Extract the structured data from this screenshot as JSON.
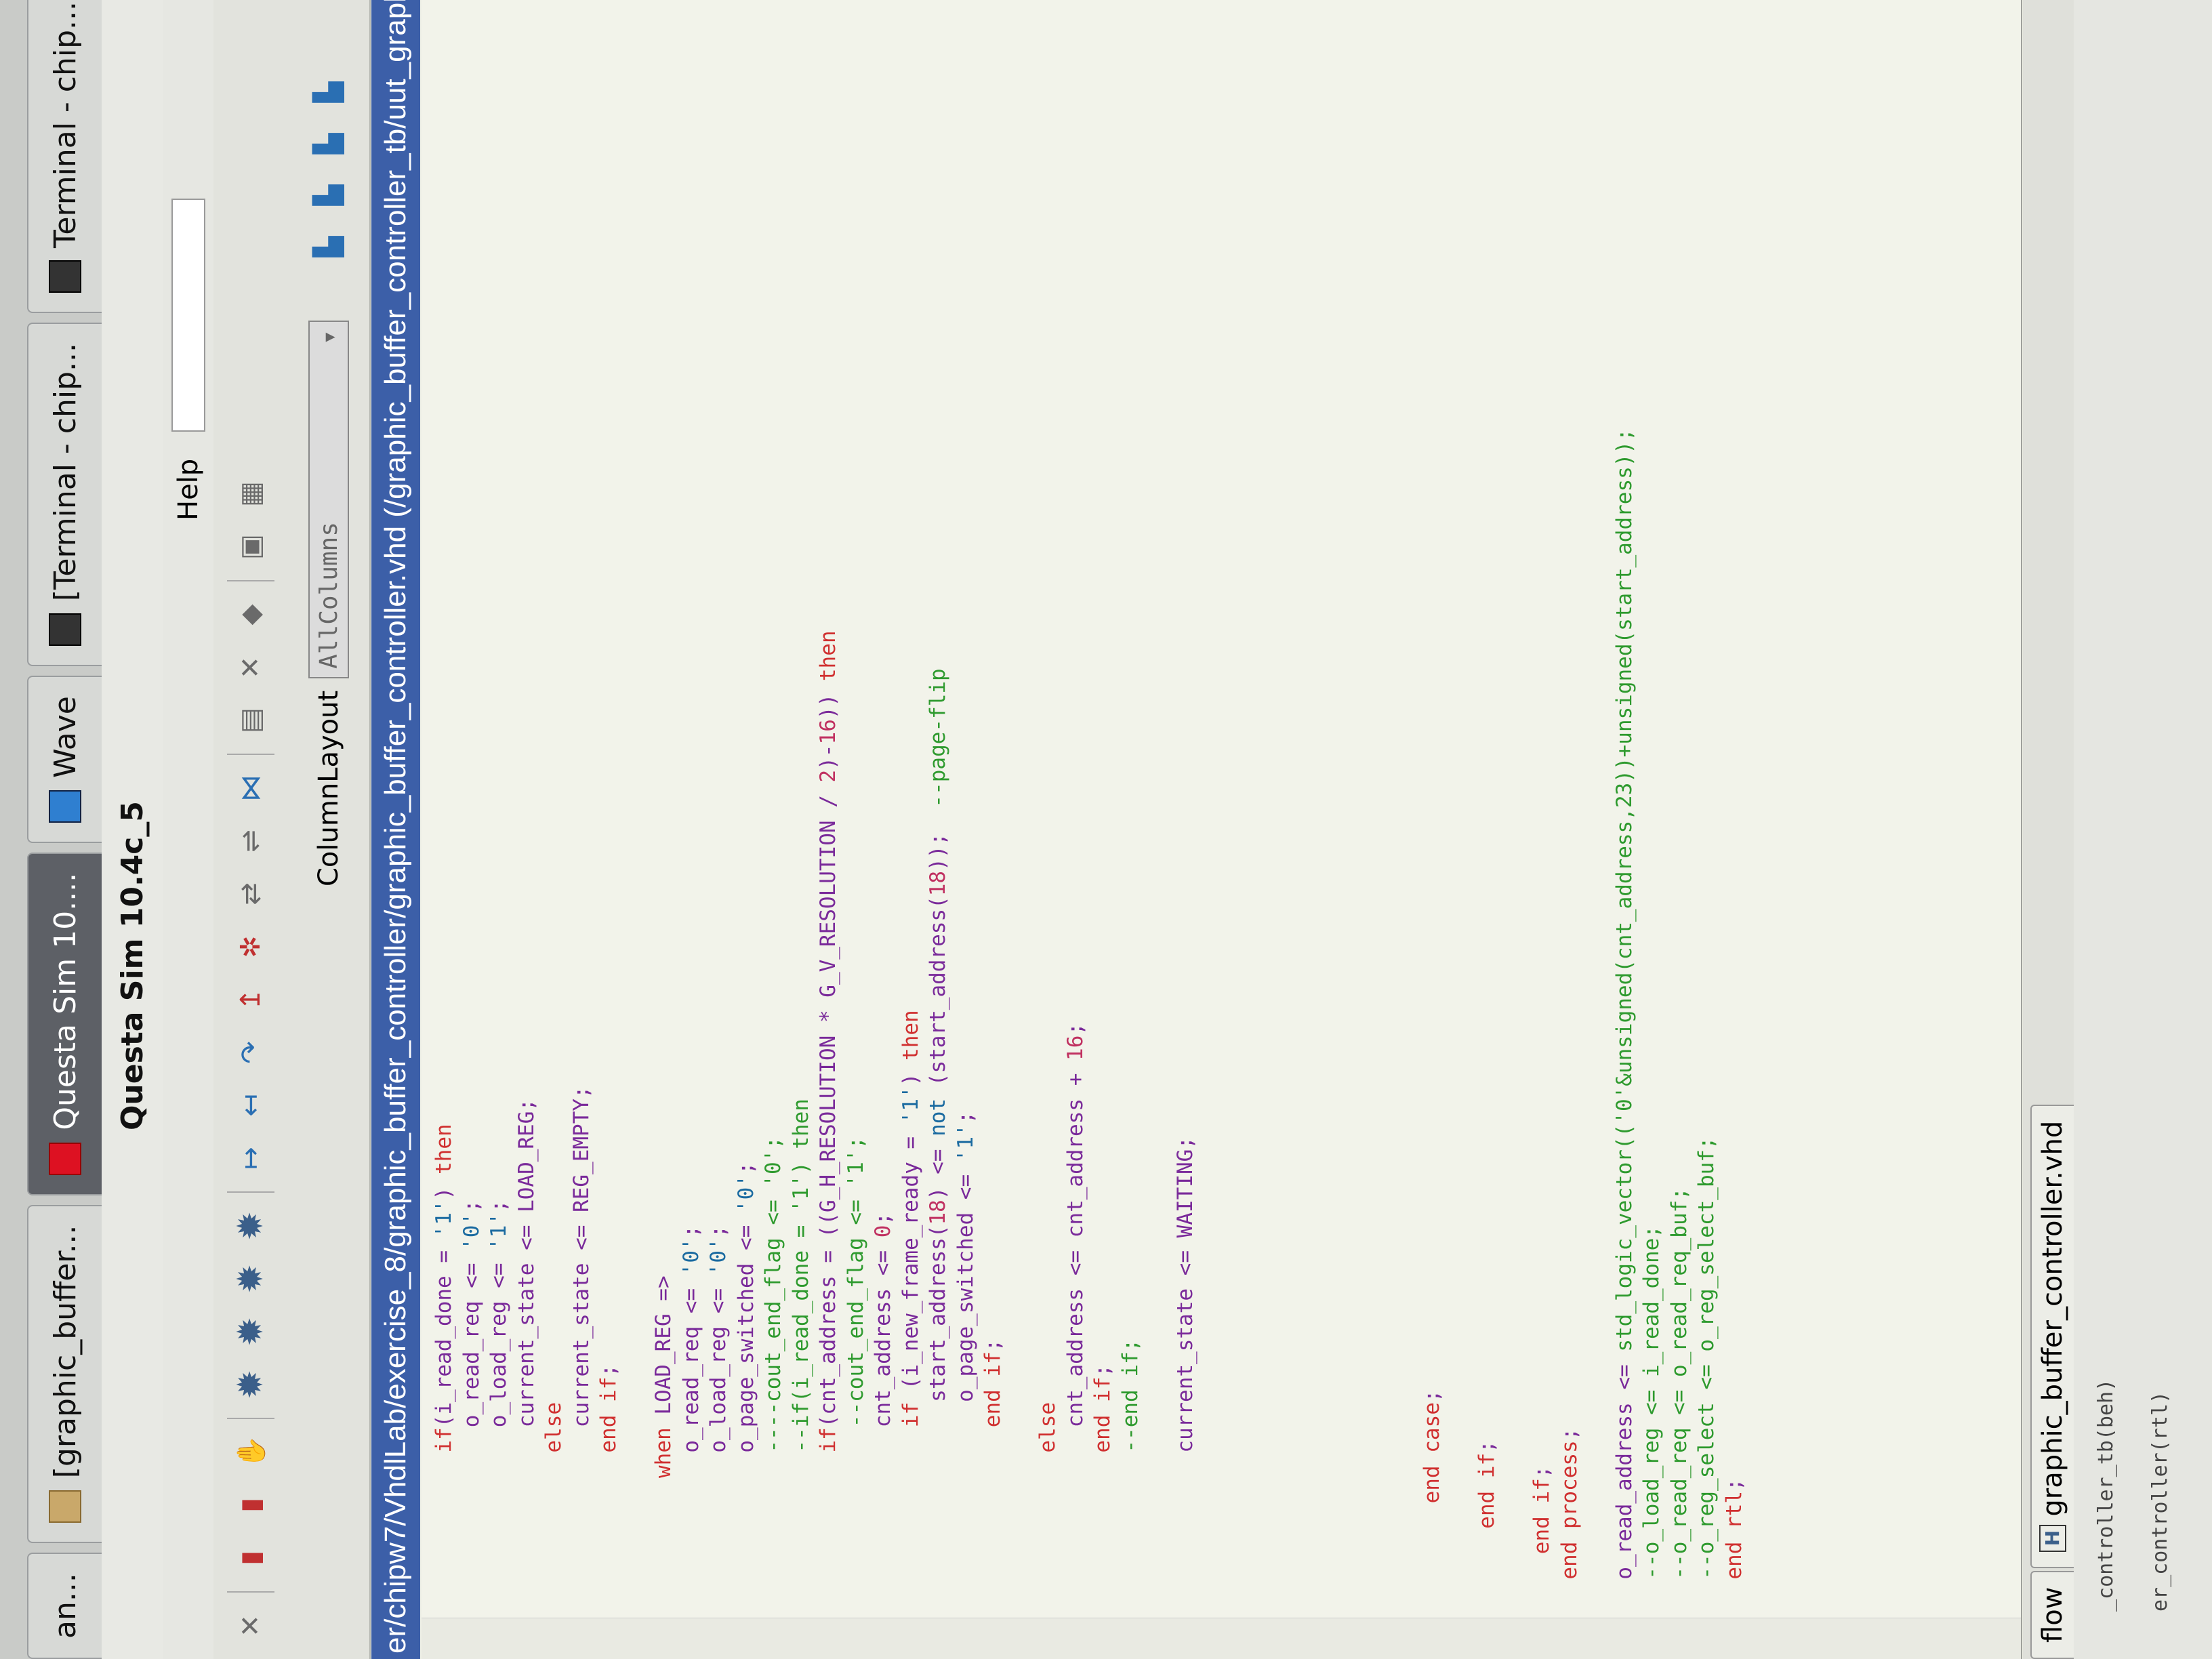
{
  "taskbar": {
    "items": [
      {
        "label": "an...",
        "icon": "app-icon"
      },
      {
        "label": "[graphic_buffer...",
        "icon": "folder-icon"
      },
      {
        "label": "Questa Sim 10....",
        "icon": "questa-icon"
      },
      {
        "label": "Wave",
        "icon": "wave-icon"
      },
      {
        "label": "[Terminal - chip...",
        "icon": "terminal-icon"
      },
      {
        "label": "Terminal - chip...",
        "icon": "terminal-icon"
      }
    ]
  },
  "window": {
    "title": "Questa Sim 10.4c_5"
  },
  "menubar": {
    "help": "Help"
  },
  "toolbar2": {
    "layout_label": "ColumnLayout",
    "layout_value": "AllColumns"
  },
  "path": "er/chipw7/VhdlLab/exercise_8/graphic_buffer_controller/graphic_buffer_controller.vhd (/graphic_buffer_controller_tb/uut_graphic_b",
  "code": [
    {
      "indent": 12,
      "segs": [
        [
          "kw",
          "if"
        ],
        [
          "id",
          "(i_read_done = "
        ],
        [
          "lit",
          "'1'"
        ],
        [
          "id",
          ") "
        ],
        [
          "kw",
          "then"
        ]
      ]
    },
    {
      "indent": 14,
      "segs": [
        [
          "id",
          "o_read_req <= "
        ],
        [
          "lit",
          "'0'"
        ],
        [
          "id",
          ";"
        ]
      ]
    },
    {
      "indent": 14,
      "segs": [
        [
          "id",
          "o_load_reg <= "
        ],
        [
          "lit",
          "'1'"
        ],
        [
          "id",
          ";"
        ]
      ]
    },
    {
      "indent": 14,
      "segs": [
        [
          "id",
          "current_state <= LOAD_REG;"
        ]
      ]
    },
    {
      "indent": 12,
      "segs": [
        [
          "kw",
          "else"
        ]
      ]
    },
    {
      "indent": 14,
      "segs": [
        [
          "id",
          "current_state <= REG_EMPTY;"
        ]
      ]
    },
    {
      "indent": 12,
      "segs": [
        [
          "kw",
          "end if"
        ],
        [
          "id",
          ";"
        ]
      ]
    },
    {
      "indent": 0,
      "segs": []
    },
    {
      "indent": 10,
      "segs": [
        [
          "kw",
          "when"
        ],
        [
          "id",
          " LOAD_REG =>"
        ]
      ]
    },
    {
      "indent": 12,
      "segs": [
        [
          "id",
          "o_read_req <= "
        ],
        [
          "lit",
          "'0'"
        ],
        [
          "id",
          ";"
        ]
      ]
    },
    {
      "indent": 12,
      "segs": [
        [
          "id",
          "o_load_reg <= "
        ],
        [
          "lit",
          "'0'"
        ],
        [
          "id",
          ";"
        ]
      ]
    },
    {
      "indent": 12,
      "segs": [
        [
          "id",
          "o_page_switched <= "
        ],
        [
          "lit",
          "'0'"
        ],
        [
          "id",
          ";"
        ]
      ]
    },
    {
      "indent": 12,
      "segs": [
        [
          "cm",
          "----cout_end_flag <= '0';"
        ]
      ]
    },
    {
      "indent": 12,
      "segs": [
        [
          "cm",
          "--if(i_read_done = '1') then"
        ]
      ]
    },
    {
      "indent": 12,
      "segs": [
        [
          "kw",
          "if"
        ],
        [
          "id",
          "(cnt_address = ((G_H_RESOLUTION * G_V_RESOLUTION / "
        ],
        [
          "nm",
          "2"
        ],
        [
          "id",
          ")-"
        ],
        [
          "nm",
          "16"
        ],
        [
          "id",
          ")) "
        ],
        [
          "kw",
          "then"
        ]
      ]
    },
    {
      "indent": 14,
      "segs": [
        [
          "cm",
          "--cout_end_flag <= '1';"
        ]
      ]
    },
    {
      "indent": 14,
      "segs": [
        [
          "id",
          "cnt_address <= "
        ],
        [
          "nm",
          "0"
        ],
        [
          "id",
          ";"
        ]
      ]
    },
    {
      "indent": 14,
      "segs": [
        [
          "kw",
          "if"
        ],
        [
          "id",
          " (i_new_frame_ready = "
        ],
        [
          "lit",
          "'1'"
        ],
        [
          "id",
          ") "
        ],
        [
          "kw",
          "then"
        ]
      ]
    },
    {
      "indent": 16,
      "segs": [
        [
          "id",
          "start_address("
        ],
        [
          "nm",
          "18"
        ],
        [
          "id",
          ") <= "
        ],
        [
          "lit",
          "not"
        ],
        [
          "id",
          " (start_address("
        ],
        [
          "nm",
          "18"
        ],
        [
          "id",
          "));  "
        ],
        [
          "cm",
          "--page-flip"
        ]
      ]
    },
    {
      "indent": 16,
      "segs": [
        [
          "id",
          "o_page_switched <= "
        ],
        [
          "lit",
          "'1'"
        ],
        [
          "id",
          ";"
        ]
      ]
    },
    {
      "indent": 14,
      "segs": [
        [
          "kw",
          "end if"
        ],
        [
          "id",
          ";"
        ]
      ]
    },
    {
      "indent": 0,
      "segs": []
    },
    {
      "indent": 12,
      "segs": [
        [
          "kw",
          "else"
        ]
      ]
    },
    {
      "indent": 14,
      "segs": [
        [
          "id",
          "cnt_address <= cnt_address + "
        ],
        [
          "nm",
          "16"
        ],
        [
          "id",
          ";"
        ]
      ]
    },
    {
      "indent": 12,
      "segs": [
        [
          "kw",
          "end if"
        ],
        [
          "id",
          ";"
        ]
      ]
    },
    {
      "indent": 12,
      "segs": [
        [
          "cm",
          "--end if;"
        ]
      ]
    },
    {
      "indent": 0,
      "segs": []
    },
    {
      "indent": 12,
      "segs": [
        [
          "id",
          "current_state <= WAITING;"
        ]
      ]
    },
    {
      "indent": 0,
      "segs": []
    },
    {
      "indent": 0,
      "segs": []
    },
    {
      "indent": 0,
      "segs": []
    },
    {
      "indent": 0,
      "segs": []
    },
    {
      "indent": 0,
      "segs": []
    },
    {
      "indent": 0,
      "segs": []
    },
    {
      "indent": 0,
      "segs": []
    },
    {
      "indent": 0,
      "segs": []
    },
    {
      "indent": 8,
      "segs": [
        [
          "kw",
          "end case"
        ],
        [
          "id",
          ";"
        ]
      ]
    },
    {
      "indent": 0,
      "segs": []
    },
    {
      "indent": 6,
      "segs": [
        [
          "kw",
          "end if"
        ],
        [
          "id",
          ";"
        ]
      ]
    },
    {
      "indent": 0,
      "segs": []
    },
    {
      "indent": 4,
      "segs": [
        [
          "kw",
          "end if"
        ],
        [
          "id",
          ";"
        ]
      ]
    },
    {
      "indent": 2,
      "segs": [
        [
          "kw",
          "end process"
        ],
        [
          "id",
          ";"
        ]
      ]
    },
    {
      "indent": 0,
      "segs": []
    },
    {
      "indent": 2,
      "segs": [
        [
          "id",
          "o_read_address <= "
        ],
        [
          "cm",
          "std_logic_vector(('0'&unsigned(cnt_address,23))+unsigned(start_address));"
        ]
      ]
    },
    {
      "indent": 2,
      "segs": [
        [
          "cm",
          "--o_load_reg <= i_read_done;"
        ]
      ]
    },
    {
      "indent": 2,
      "segs": [
        [
          "cm",
          "--o_read_req <= o_read_req_buf;"
        ]
      ]
    },
    {
      "indent": 2,
      "segs": [
        [
          "cm",
          "--o_reg_select <= o_reg_select_buf;"
        ]
      ]
    },
    {
      "indent": 2,
      "segs": [
        [
          "kw",
          "end rtl"
        ],
        [
          "id",
          ";"
        ]
      ]
    }
  ],
  "tabs": [
    {
      "label": "flow"
    },
    {
      "label": "graphic_buffer_controller.vhd"
    }
  ],
  "lower": [
    "_controller_tb(beh)",
    "er_controller(rtl)"
  ]
}
